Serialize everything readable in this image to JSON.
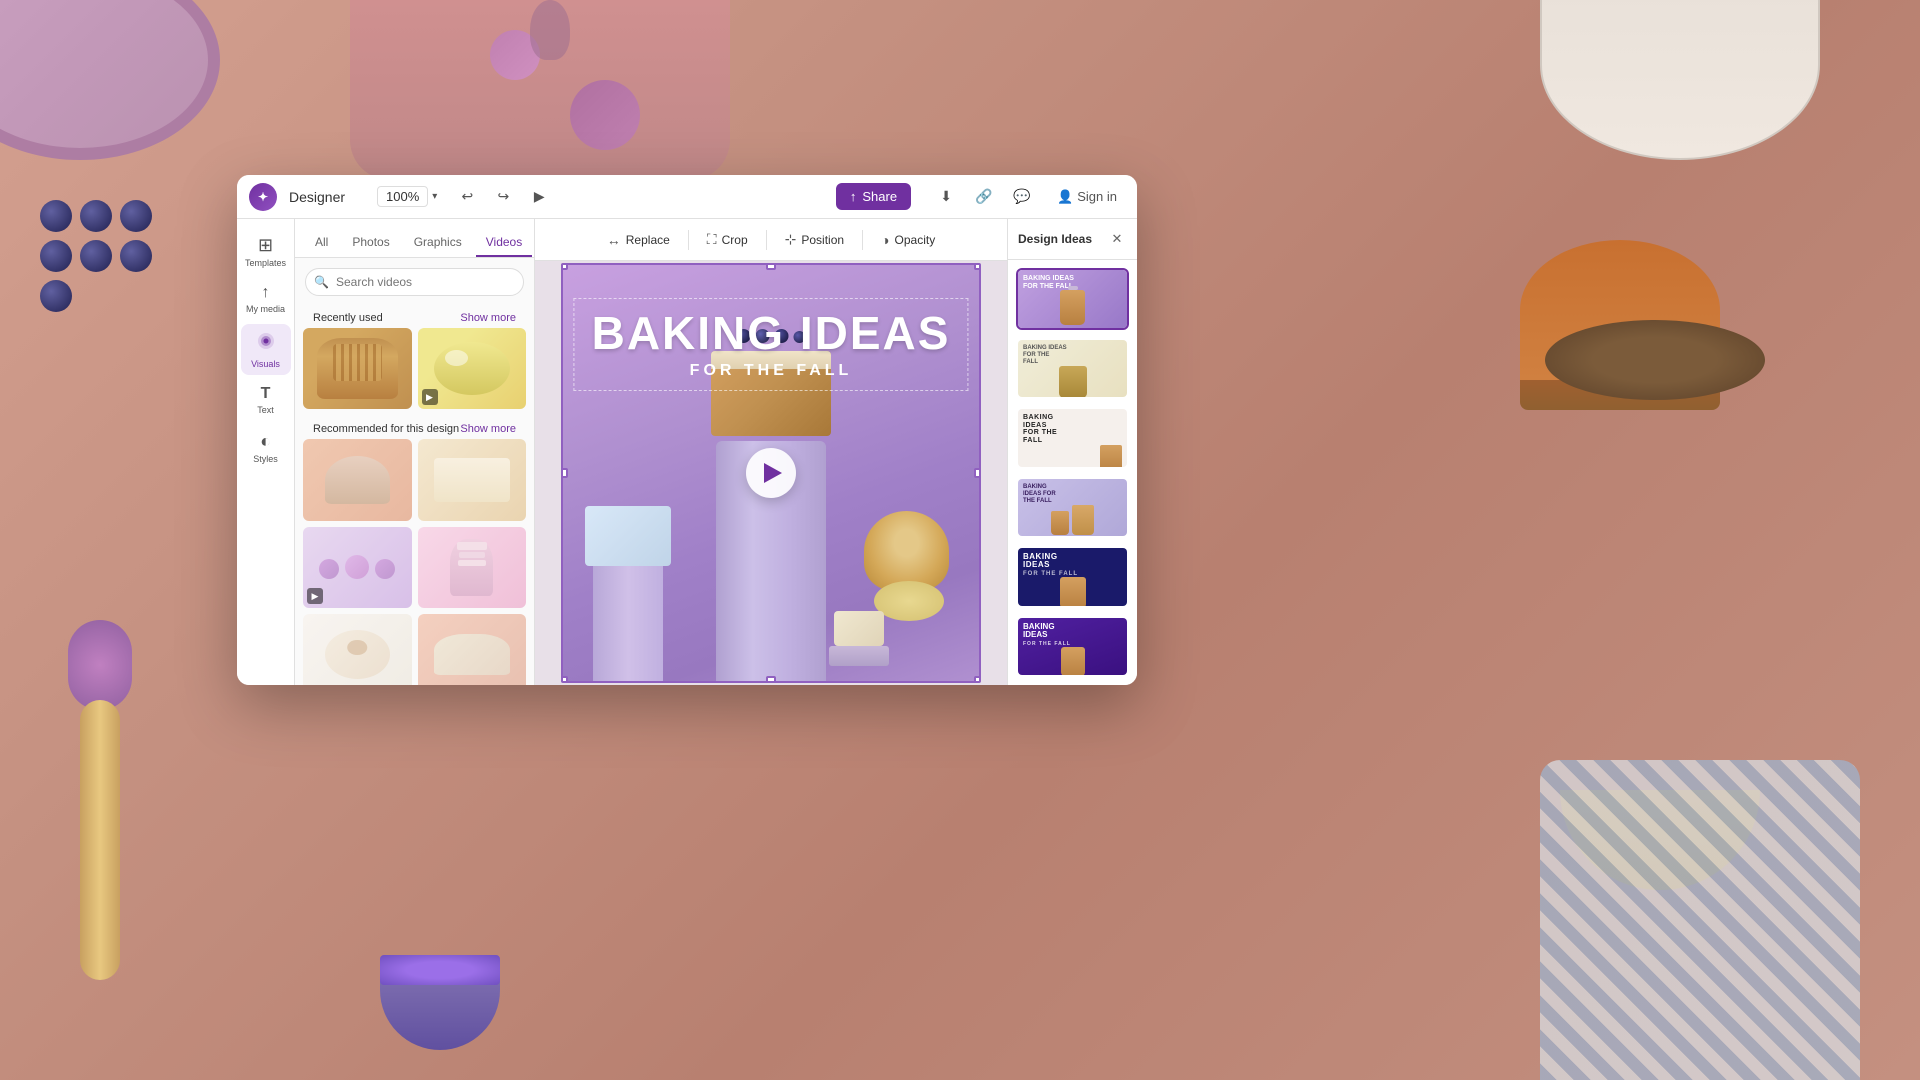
{
  "app": {
    "name": "Designer",
    "logo_symbol": "✦",
    "zoom": "100%",
    "share_label": "Share",
    "sign_in_label": "Sign in"
  },
  "toolbar": {
    "replace_label": "Replace",
    "crop_label": "Crop",
    "position_label": "Position",
    "opacity_label": "Opacity"
  },
  "sidebar": {
    "items": [
      {
        "id": "templates",
        "label": "Templates",
        "icon": "⊞"
      },
      {
        "id": "my_media",
        "label": "My media",
        "icon": "↑"
      },
      {
        "id": "visuals",
        "label": "Visuals",
        "icon": "◈"
      },
      {
        "id": "text",
        "label": "Text",
        "icon": "T"
      },
      {
        "id": "styles",
        "label": "Styles",
        "icon": "◐"
      }
    ],
    "active": "visuals"
  },
  "media_panel": {
    "tabs": [
      "All",
      "Photos",
      "Graphics",
      "Videos"
    ],
    "active_tab": "Videos",
    "search_placeholder": "Search videos",
    "recently_used_label": "Recently used",
    "show_more_1": "Show more",
    "recommended_label": "Recommended for this design",
    "show_more_2": "Show more"
  },
  "canvas": {
    "title_line1": "BAKING IDEAS",
    "title_line2": "FOR THE FALL",
    "subtitle": "FOR THE FALL"
  },
  "design_ideas": {
    "title": "Design Ideas",
    "close_icon": "✕",
    "ideas": [
      {
        "id": 1,
        "style": "purple-gradient"
      },
      {
        "id": 2,
        "style": "yellow-light"
      },
      {
        "id": 3,
        "style": "dark-text"
      },
      {
        "id": 4,
        "style": "blue-soft"
      },
      {
        "id": 5,
        "style": "dark-navy"
      },
      {
        "id": 6,
        "style": "purple-dark"
      }
    ]
  }
}
